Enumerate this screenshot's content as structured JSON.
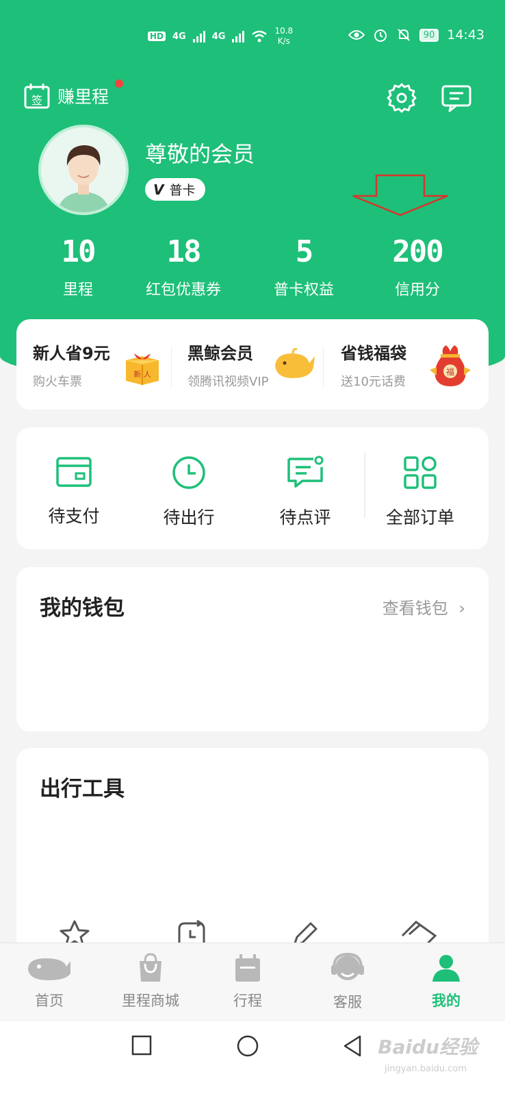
{
  "status_bar": {
    "hd": "HD",
    "net1": "4G",
    "net2": "4G",
    "speed_value": "10.8",
    "speed_unit": "K/s",
    "battery": "90",
    "time": "14:43"
  },
  "header": {
    "earn_icon_text": "签",
    "earn_label": "赚里程",
    "has_notification_dot": true
  },
  "profile": {
    "name": "尊敬的会员",
    "tier_icon": "V",
    "tier": "普卡"
  },
  "stats": [
    {
      "value": "10",
      "label": "里程"
    },
    {
      "value": "18",
      "label": "红包优惠券"
    },
    {
      "value": "5",
      "label": "普卡权益"
    },
    {
      "value": "200",
      "label": "信用分"
    }
  ],
  "promos": [
    {
      "title": "新人省9元",
      "subtitle": "购火车票",
      "icon": "gift-box-icon",
      "icon_text": "新 人"
    },
    {
      "title": "黑鲸会员",
      "subtitle": "领腾讯视频VIP",
      "icon": "whale-icon"
    },
    {
      "title": "省钱福袋",
      "subtitle": "送10元话费",
      "icon": "lucky-bag-icon",
      "icon_text": "福"
    }
  ],
  "orders": [
    {
      "label": "待支付",
      "icon": "wallet-icon"
    },
    {
      "label": "待出行",
      "icon": "clock-icon"
    },
    {
      "label": "待点评",
      "icon": "comment-icon"
    },
    {
      "label": "全部订单",
      "icon": "grid-icon"
    }
  ],
  "wallet": {
    "title": "我的钱包",
    "link": "查看钱包"
  },
  "tools": {
    "title": "出行工具"
  },
  "tabs": [
    {
      "label": "首页",
      "icon": "whale-home-icon"
    },
    {
      "label": "里程商城",
      "icon": "shopping-bag-icon"
    },
    {
      "label": "行程",
      "icon": "calendar-icon"
    },
    {
      "label": "客服",
      "icon": "headset-icon"
    },
    {
      "label": "我的",
      "icon": "person-icon",
      "active": true
    }
  ],
  "watermark": {
    "text": "Baidu经验",
    "sub": "jingyan.baidu.com"
  },
  "colors": {
    "brand": "#1ebf79",
    "alert": "#f5433d",
    "arrow": "#d9342b"
  }
}
